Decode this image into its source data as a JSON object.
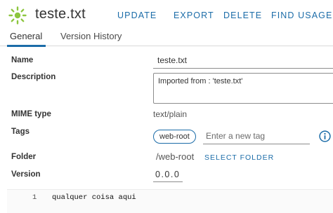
{
  "header": {
    "icon": "file-sun-icon",
    "title": "teste.txt",
    "actions": {
      "update": "UPDATE",
      "export": "EXPORT",
      "delete": "DELETE",
      "find_usages": "FIND USAGES"
    }
  },
  "tabs": {
    "general": "General",
    "version_history": "Version History",
    "active": "General"
  },
  "form": {
    "name": {
      "label": "Name",
      "value": "teste.txt"
    },
    "description": {
      "label": "Description",
      "value": "Imported from : 'teste.txt'"
    },
    "mime_type": {
      "label": "MIME type",
      "value": "text/plain"
    },
    "tags": {
      "label": "Tags",
      "tag": "web-root",
      "placeholder": "Enter a new tag",
      "info_icon": "info-circle-icon"
    },
    "folder": {
      "label": "Folder",
      "value": "/web-root",
      "select_label": "SELECT FOLDER"
    },
    "version": {
      "label": "Version",
      "value": "0.0.0"
    }
  },
  "editor": {
    "line_number": "1",
    "line_content": "qualquer coisa aqui"
  },
  "colors": {
    "accent": "#1b6ca8",
    "icon_green": "#8dc63f",
    "text": "#333333"
  }
}
